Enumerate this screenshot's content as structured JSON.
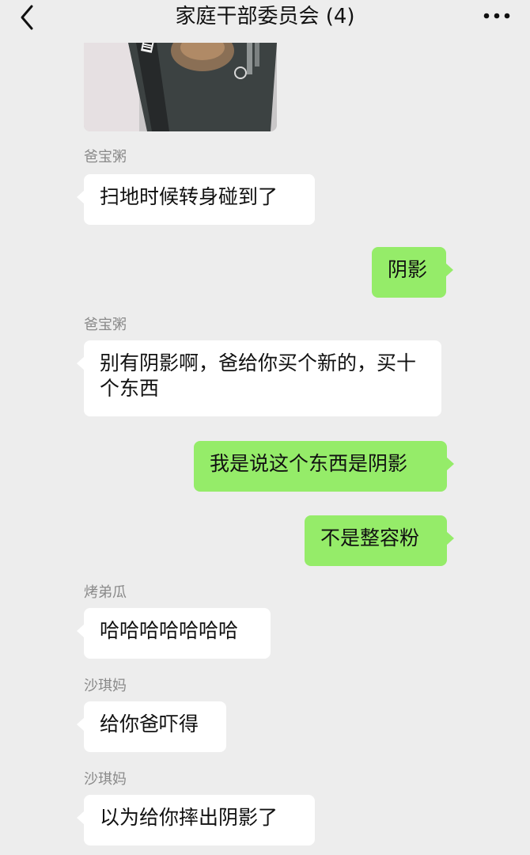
{
  "header": {
    "title": "家庭干部委员会 (4)",
    "back_icon": "chevron-left-icon",
    "more_icon": "more-dots-icon"
  },
  "messages": [
    {
      "sender": "爸宝粥",
      "text": "扫地时候转身碰到了",
      "direction": "in"
    },
    {
      "text": "阴影",
      "direction": "out"
    },
    {
      "sender": "爸宝粥",
      "text": "别有阴影啊，爸给你买个新的，买十个东西",
      "direction": "in"
    },
    {
      "text": "我是说这个东西是阴影",
      "direction": "out"
    },
    {
      "text": "不是整容粉",
      "direction": "out"
    },
    {
      "sender": "烤弟瓜",
      "text": "哈哈哈哈哈哈哈",
      "direction": "in"
    },
    {
      "sender": "沙琪妈",
      "text": "给你爸吓得",
      "direction": "in"
    },
    {
      "sender": "沙琪妈",
      "text": "以为给你摔出阴影了",
      "direction": "in"
    }
  ],
  "colors": {
    "background": "#ededed",
    "outgoing_bubble": "#95ec69",
    "incoming_bubble": "#ffffff"
  }
}
